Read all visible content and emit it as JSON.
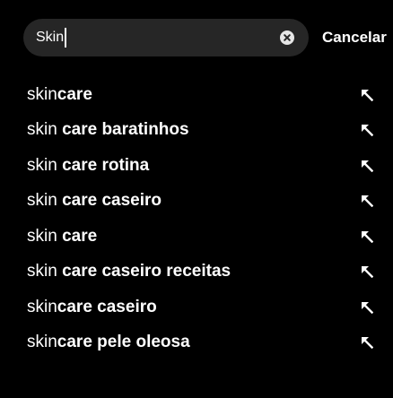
{
  "search": {
    "query": "Skin",
    "clear_icon": "clear-circle-x-icon",
    "cancel_label": "Cancelar"
  },
  "suggestions": [
    {
      "typed": "skin",
      "completion": "care",
      "fill_icon": "arrow-up-left-icon"
    },
    {
      "typed": "skin",
      "completion": " care baratinhos",
      "fill_icon": "arrow-up-left-icon"
    },
    {
      "typed": "skin",
      "completion": " care rotina",
      "fill_icon": "arrow-up-left-icon"
    },
    {
      "typed": "skin",
      "completion": " care caseiro",
      "fill_icon": "arrow-up-left-icon"
    },
    {
      "typed": "skin",
      "completion": " care",
      "fill_icon": "arrow-up-left-icon"
    },
    {
      "typed": "skin",
      "completion": " care caseiro receitas",
      "fill_icon": "arrow-up-left-icon"
    },
    {
      "typed": "skin",
      "completion": "care caseiro",
      "fill_icon": "arrow-up-left-icon"
    },
    {
      "typed": "skin",
      "completion": "care pele oleosa",
      "fill_icon": "arrow-up-left-icon"
    }
  ],
  "colors": {
    "background": "#000000",
    "field": "#262626",
    "text": "#ffffff",
    "clear_icon_bg": "#e6e6e6"
  }
}
